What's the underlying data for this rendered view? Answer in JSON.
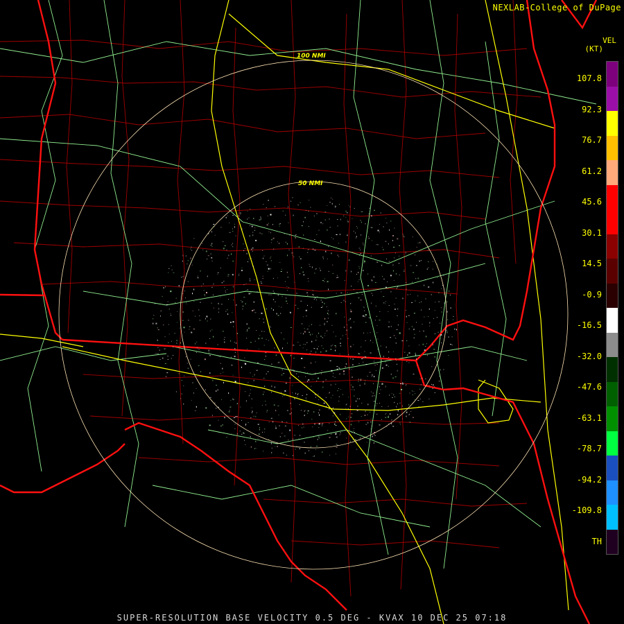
{
  "credit": "NEXLAB-College of DuPage",
  "footer": "SUPER-RESOLUTION BASE VELOCITY 0.5 DEG - KVAX 10 DEC 25 07:18",
  "scale": {
    "title": "VEL",
    "unit": "(KT)",
    "labels": [
      "107.8",
      "92.3",
      "76.7",
      "61.2",
      "45.6",
      "30.1",
      "14.5",
      "-0.9",
      "-16.5",
      "-32.0",
      "-47.6",
      "-63.1",
      "-78.7",
      "-94.2",
      "-109.8",
      "TH"
    ]
  },
  "range_rings": [
    "100 NMI",
    "50 NMI"
  ],
  "colors": {
    "state_lines": "#ff0000",
    "county_lines": "#b00000",
    "interstates": "#ffff00",
    "highways": "#90ee90",
    "rings": "#ffe4b5",
    "scale_text": "#ffff00"
  },
  "colorbar_colors": [
    "#7d007d",
    "#9b0fa8",
    "#ffff00",
    "#ffc000",
    "#ffa87a",
    "#ff0000",
    "#ff0000",
    "#8b0000",
    "#5a0000",
    "#2a0000",
    "#ffffff",
    "#8c8c8c",
    "#003000",
    "#006000",
    "#009000",
    "#00ff40",
    "#1a4fbf",
    "#1e90ff",
    "#00bfff",
    "#200020"
  ]
}
